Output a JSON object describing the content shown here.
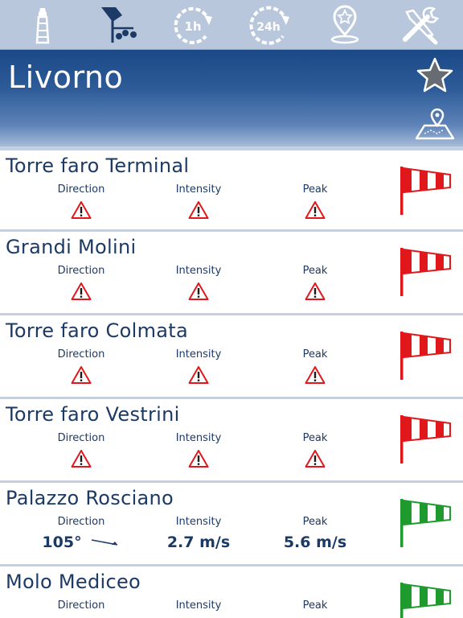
{
  "toolbar": {
    "items": [
      {
        "icon": "lighthouse-icon"
      },
      {
        "icon": "weather-station-icon"
      },
      {
        "icon": "history-1h-icon",
        "label": "1h"
      },
      {
        "icon": "history-24h-icon",
        "label": "24h"
      },
      {
        "icon": "location-pin-star-icon"
      },
      {
        "icon": "settings-tools-icon"
      }
    ]
  },
  "header": {
    "city": "Livorno",
    "favorite_icon": "star-icon",
    "map_icon": "map-icon"
  },
  "columns": {
    "direction": "Direction",
    "intensity": "Intensity",
    "peak": "Peak"
  },
  "colors": {
    "alert_red": "#e0181c",
    "ok_green": "#1e9a2e",
    "navy": "#1c3a66"
  },
  "stations": [
    {
      "name": "Torre faro Terminal",
      "status": "unavailable",
      "sock_color": "#e0181c"
    },
    {
      "name": "Grandi Molini",
      "status": "unavailable",
      "sock_color": "#e0181c"
    },
    {
      "name": "Torre faro Colmata",
      "status": "unavailable",
      "sock_color": "#e0181c"
    },
    {
      "name": "Torre faro Vestrini",
      "status": "unavailable",
      "sock_color": "#e0181c"
    },
    {
      "name": "Palazzo Rosciano",
      "status": "ok",
      "sock_color": "#1e9a2e",
      "direction": "105°",
      "direction_degrees": 105,
      "intensity": "2.7 m/s",
      "peak": "5.6 m/s"
    },
    {
      "name": "Molo Mediceo",
      "status": "ok",
      "sock_color": "#1e9a2e"
    }
  ]
}
